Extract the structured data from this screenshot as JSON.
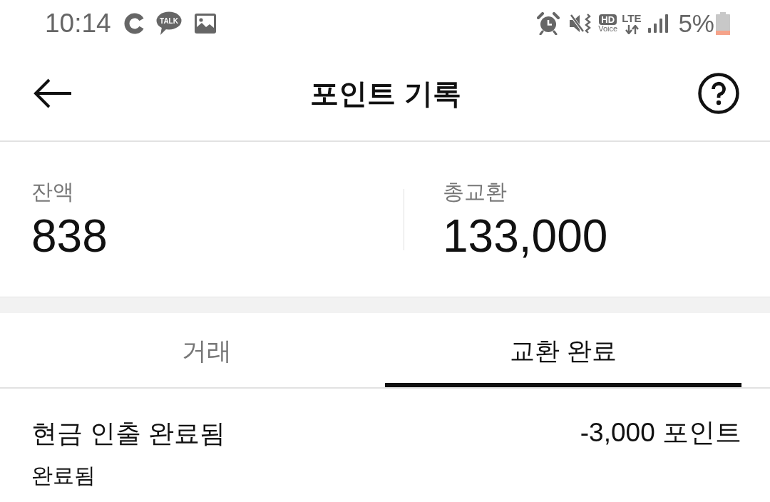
{
  "status_bar": {
    "time": "10:14",
    "talk_logo_text": "TALK",
    "hd_label": "HD",
    "voice_label": "Voice",
    "network": "LTE",
    "battery": "5%"
  },
  "header": {
    "title": "포인트 기록"
  },
  "summary": [
    {
      "label": "잔액",
      "value": "838"
    },
    {
      "label": "총교환",
      "value": "133,000"
    }
  ],
  "tabs": [
    {
      "label": "거래",
      "selected": false
    },
    {
      "label": "교환 완료",
      "selected": true
    }
  ],
  "transactions": [
    {
      "title": "현금 인출 완료됨",
      "amount": "-3,000 포인트",
      "status": "완료됨"
    }
  ]
}
